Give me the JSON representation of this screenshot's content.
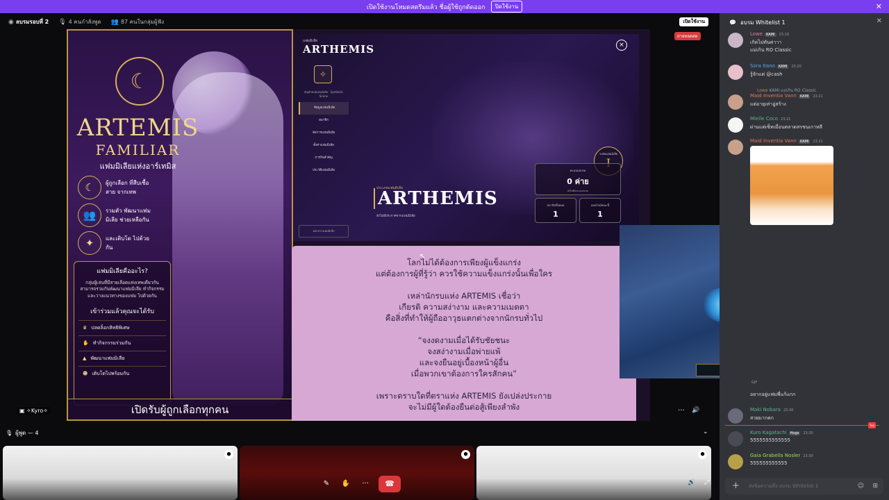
{
  "banner": {
    "text": "เปิดใช้งานโหมดสตรีมแล้ว ชื่อผู้ใช้ถูกตัดออก",
    "button": "ปิดใช้งาน",
    "close": "✕"
  },
  "topbar": {
    "title": "ลบรมรอบที่ 2",
    "speaking": "4 คนกำลังพูด",
    "members": "87 คนในกลุ่มผู้ฟัง",
    "live_button": "เปิดใช้งาน",
    "live_badge": "ถ่ายทอดสด"
  },
  "poster": {
    "title1": "ARTEMIS",
    "title2": "FAMILIAR",
    "subtitle": "แฟมมิเลียแห่งอาร์เทมิส",
    "features": [
      "ผู้ถูกเลือก ที่สืบเชื้อสาย จากเทพ",
      "รวมตัว พัฒนาแฟมมิเลีย ช่วยเหลือกัน",
      "และเติบโต ไปด้วยกัน"
    ],
    "what_title": "แฟมมิเลียคืออะไร?",
    "what_text": "กลุ่มผู้เล่นที่มีสายเลือดแห่งเทพเดียวกัน สามารถรวมกันพัฒนาแฟมมิเลีย ทำกิจกรรม และวางแนวทางของแฟม ไปด้วยกัน",
    "join_title": "เข้าร่วมแล้วคุณจะได้รับ",
    "join_items": [
      "ปลดล็อกสิทธิพิเศษ",
      "ทำกิจกรรมร่วมกัน",
      "พัฒนาแฟมมิเลีย",
      "เติบโตไปพร้อมกัน"
    ],
    "footer": "เปิดรับผู้ถูกเลือกทุกคน"
  },
  "game": {
    "small": "แฟมมิเลีย",
    "brand": "ARTHEMIS",
    "close": "×",
    "crest_caption": "สัญลักษณ์แฟมมิเลีย · Symbolic Scene",
    "nav": [
      "ข้อมูลแฟมมิเลีย",
      "สมาชิก",
      "จัดการแฟมมิเลีย",
      "ตั้งค่าแฟมมิเลีย",
      "ภารกิจสำคัญ",
      "ประวัติแฟมมิเลีย"
    ],
    "nav_bottom": "ออกจากแฟมมิเลีย",
    "category": "ประเภทแฟมมิเลีย",
    "name": "ARTHEMIS",
    "note": "ยังไม่มีประกาศจากแฟมมิเลีย",
    "rank_label": "ระดับแฟมมิเลีย",
    "rank": "I",
    "cards": [
      {
        "label": "คะแนนสะสม",
        "value": "0 ค่าย",
        "sub": "ยังไม่มีคะแนนสะสม"
      },
      {
        "label": "สมาชิกทั้งหมด",
        "value": "1",
        "sub": ""
      },
      {
        "label": "ออนไลน์ขณะนี้",
        "value": "1",
        "sub": ""
      }
    ]
  },
  "story": {
    "p1": [
      "โลกไม่ได้ต้องการเพียงผู้แข็งแกร่ง",
      "แต่ต้องการผู้ที่รู้ว่า ควรใช้ความแข็งแกร่งนั้นเพื่อใคร"
    ],
    "p2": [
      "เหล่านักรบแห่ง ARTEMIS เชื่อว่า",
      "เกียรติ ความสง่างาม และความเมตตา",
      "คือสิ่งที่ทำให้ผู้ถืออาวุธแตกต่างจากนักรบทั่วไป"
    ],
    "p3": [
      "“จงงดงามเมื่อได้รับชัยชนะ",
      "จงสง่างามเมื่อพ่ายแพ้",
      "และจงยืนอยู่เบื้องหน้าผู้อื่น",
      "เมื่อพวกเขาต้องการใครสักคน”"
    ],
    "p4": [
      "เพราะตราบใดที่ตราแห่ง ARTEMIS ยังเปล่งประกาย",
      "จะไม่มีผู้ใดต้องยืนต่อสู้เพียงลำพัง"
    ]
  },
  "video": {
    "user": "✧Kyro✧",
    "more": "···",
    "volume": "🔊"
  },
  "speakers": {
    "label": "ผู้พูด — 4"
  },
  "chat": {
    "header": "อบรม Whitelist 1",
    "input_placeholder": "ส่งข้อความถึง อบรม Whitelist 1",
    "gif": "GIF",
    "new_tag": "ใหม่",
    "messages": [
      {
        "name": "Lowe",
        "tag": "KAMI",
        "time": "23:19",
        "text": "เกิดไม่ทันค่าาา",
        "text2": "แม่เกิน RO Classic",
        "color": "#e8799a"
      },
      {
        "name": "Sora Itano",
        "tag": "KAMI",
        "time": "23:20",
        "text": "รู้จักแต่ @cash",
        "text2": "",
        "color": "#5ba8e8"
      },
      {
        "name": "Maid Inventia Vann",
        "tag": "KAMI",
        "time": "23:21",
        "text": "แต่อายุเท่าอู่สร้าง",
        "text2": "",
        "color": "#e8795a"
      },
      {
        "name": "Mielle Coco",
        "tag": "",
        "time": "23:21",
        "text": "ผ่านแต่เซ็ทเมื่อนตลาดสรชนเกาหลี",
        "text2": "",
        "color": "#5ab88a"
      },
      {
        "name": "Maid Inventia Vann",
        "tag": "KAMI",
        "time": "23:21",
        "text": "",
        "text2": "",
        "color": "#e8795a"
      },
      {
        "name": "",
        "tag": "",
        "time": "",
        "text": "อยากอยู่แฟมพี่แก้แกก",
        "text2": "",
        "color": "#fff"
      },
      {
        "name": "Maki Nobara",
        "tag": "",
        "time": "23:30",
        "text": "สวยมากคก",
        "text2": "",
        "color": "#5ab88a"
      },
      {
        "name": "Kuro Kagatachi",
        "tag": "Hogs",
        "time": "23:30",
        "text": "5555555555555",
        "text2": "",
        "color": "#5ab88a"
      },
      {
        "name": "Gaia Grabella Nosler",
        "tag": "",
        "time": "23:30",
        "text": "555555555555",
        "text2": "",
        "color": "#9be05a"
      }
    ],
    "reply": {
      "name": "Lowe",
      "tag": "KAMI",
      "text": "แม่เกิน RO Classic"
    }
  }
}
